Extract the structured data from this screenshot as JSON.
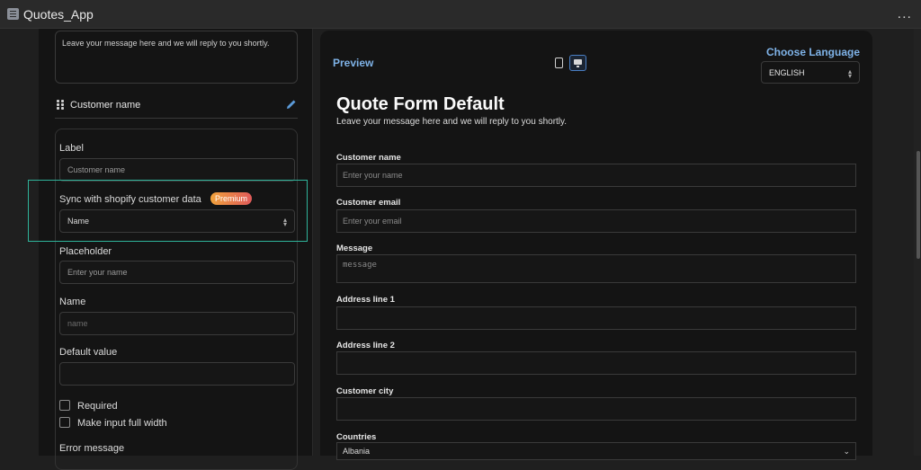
{
  "app": {
    "title": "Quotes_App",
    "more_label": "..."
  },
  "editor": {
    "message_text": "Leave your message here and we will reply to you shortly.",
    "field_title": "Customer name",
    "label_heading": "Label",
    "label_value": "Customer name",
    "sync_heading": "Sync with shopify customer data",
    "premium_badge": "Premium",
    "sync_value": "Name",
    "placeholder_heading": "Placeholder",
    "placeholder_value": "Enter your name",
    "name_heading": "Name",
    "name_value": "name",
    "default_heading": "Default value",
    "default_value": "",
    "required_label": "Required",
    "fullwidth_label": "Make input full width",
    "error_heading": "Error message"
  },
  "preview": {
    "heading": "Preview",
    "language_heading": "Choose Language",
    "language_value": "ENGLISH",
    "form_title": "Quote Form Default",
    "form_desc": "Leave your message here and we will reply to you shortly.",
    "fields": {
      "customer_name": {
        "label": "Customer name",
        "placeholder": "Enter your name"
      },
      "customer_email": {
        "label": "Customer email",
        "placeholder": "Enter your email"
      },
      "message": {
        "label": "Message",
        "placeholder": "message"
      },
      "address1": {
        "label": "Address line 1",
        "placeholder": ""
      },
      "address2": {
        "label": "Address line 2",
        "placeholder": ""
      },
      "city": {
        "label": "Customer city",
        "placeholder": ""
      },
      "countries": {
        "label": "Countries",
        "value": "Albania"
      }
    }
  },
  "colors": {
    "accent": "#7fb3e8",
    "highlight": "#2fb39a",
    "premium_start": "#f0a23c",
    "premium_end": "#e05a5a"
  }
}
